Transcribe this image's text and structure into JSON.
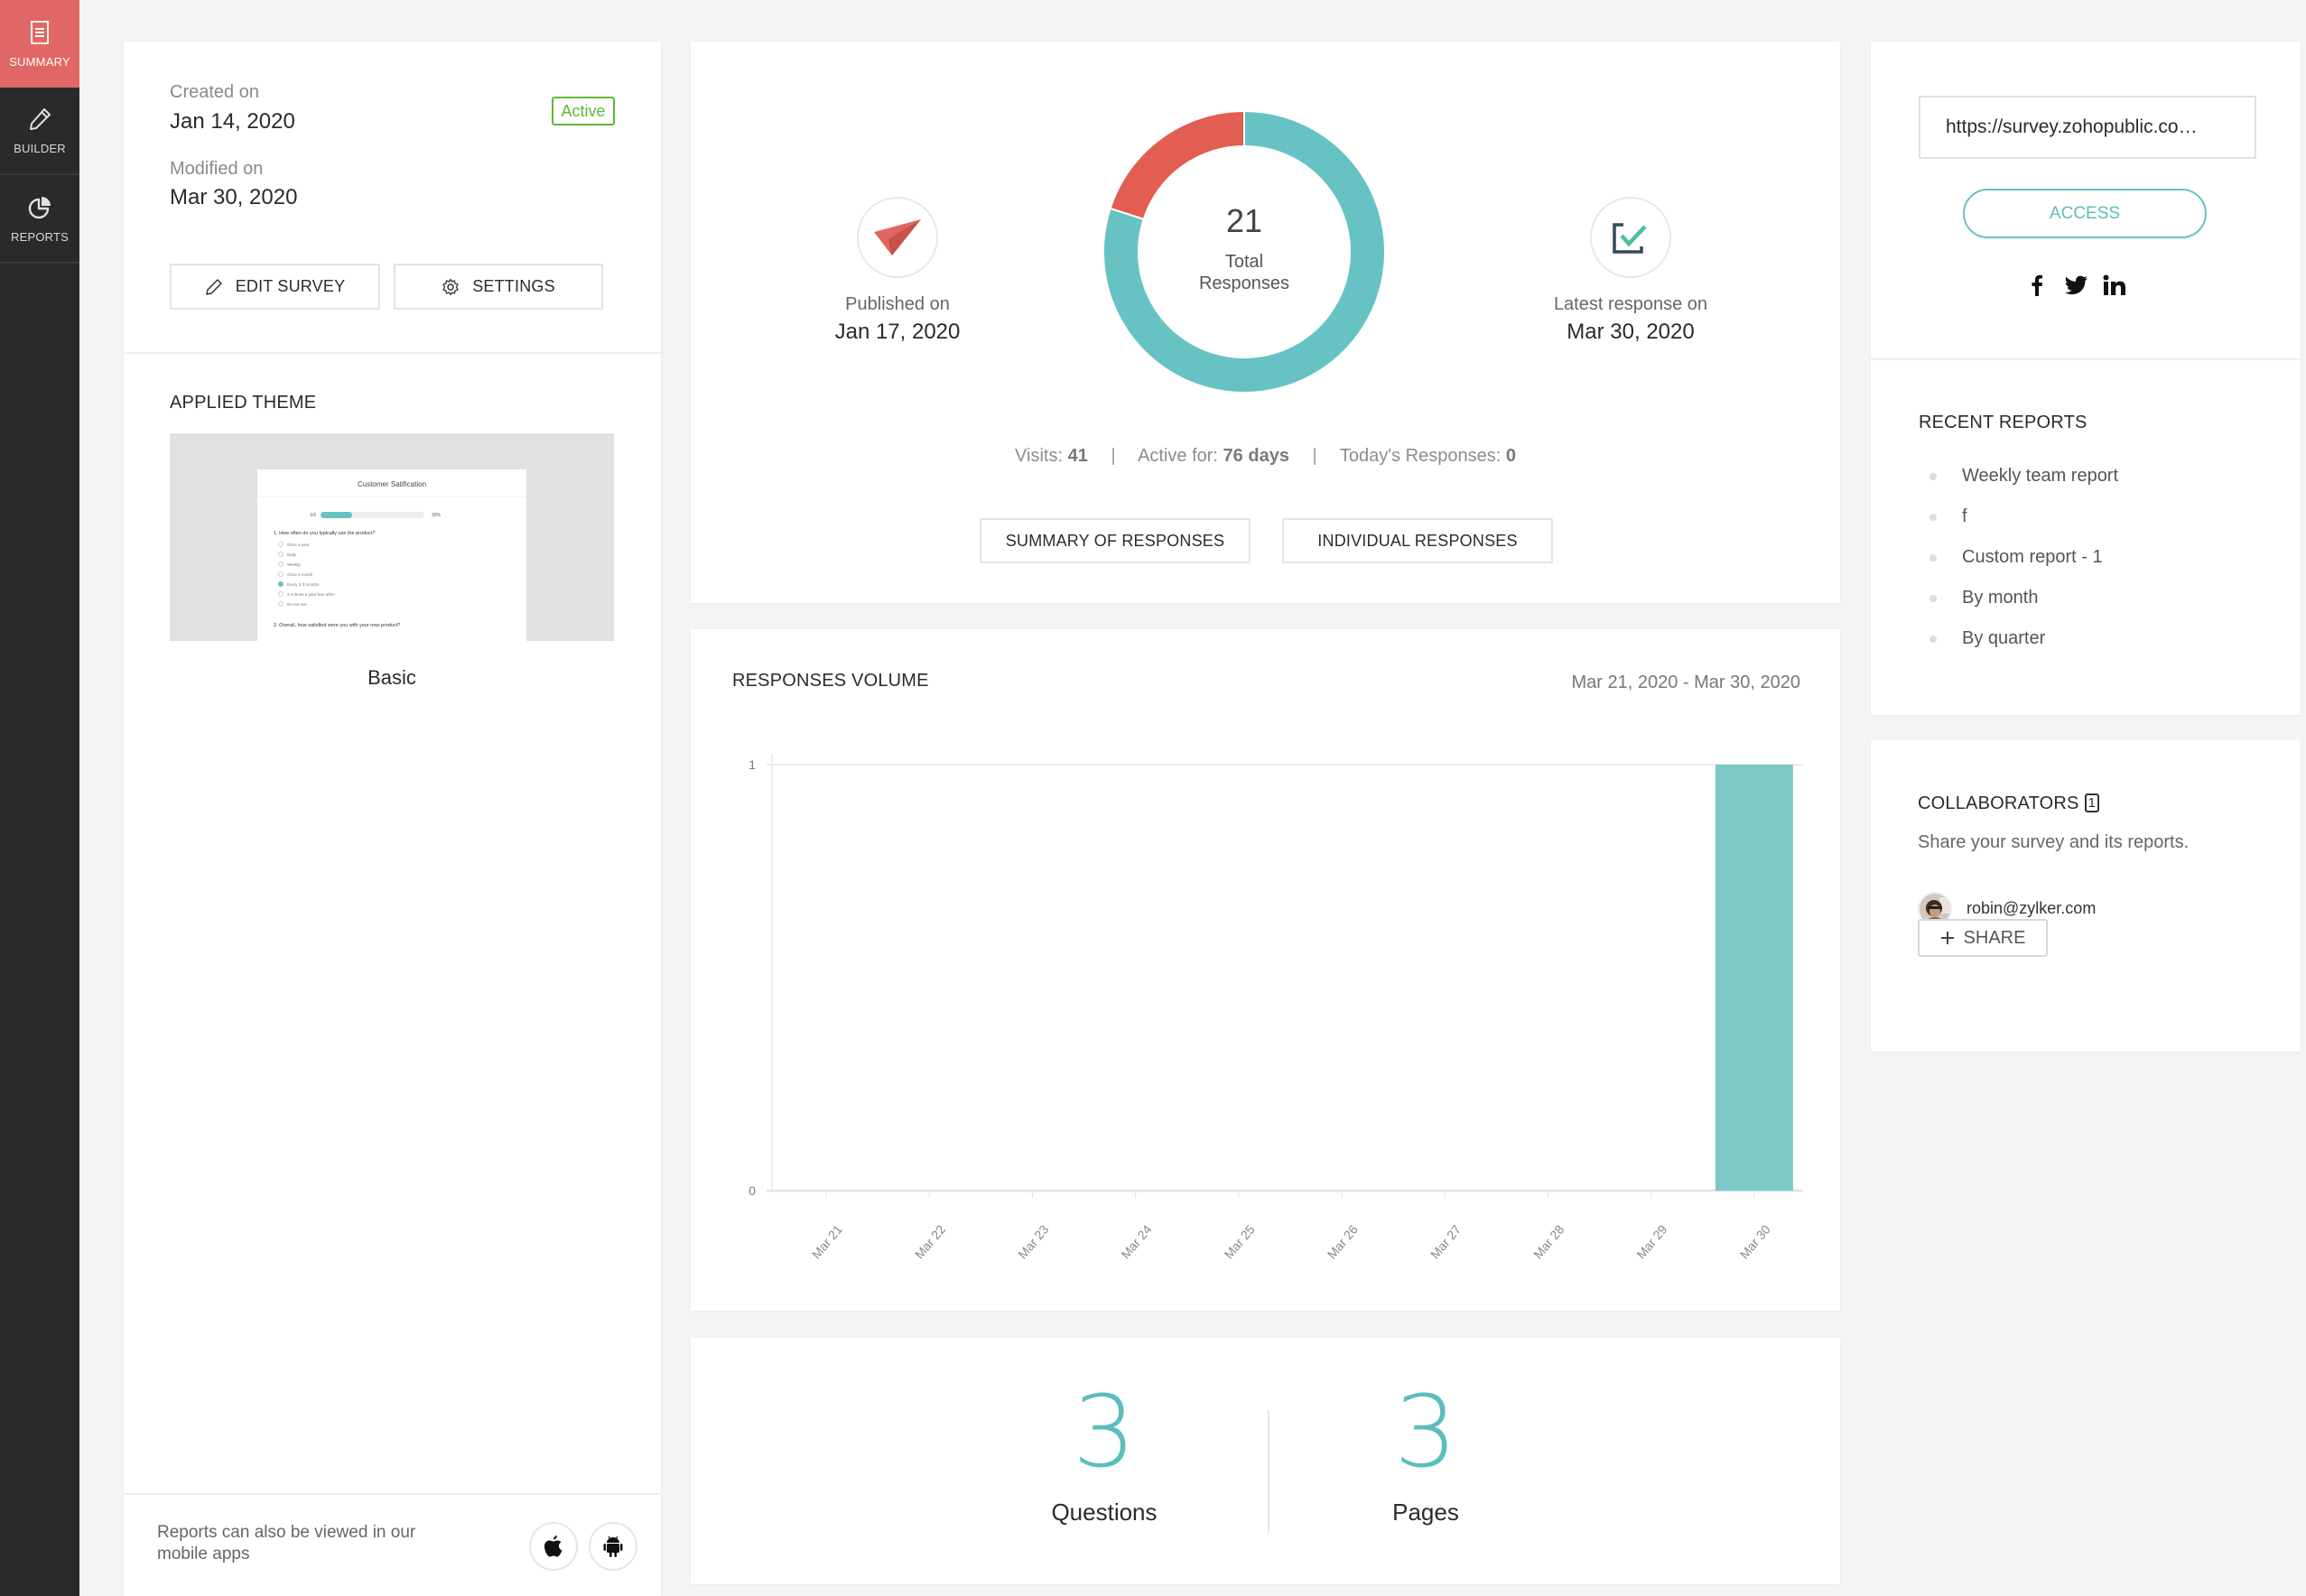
{
  "sidebar": {
    "items": [
      {
        "label": "SUMMARY",
        "icon": "document-icon",
        "active": true
      },
      {
        "label": "BUILDER",
        "icon": "pencil-icon",
        "active": false
      },
      {
        "label": "REPORTS",
        "icon": "pie-chart-icon",
        "active": false
      }
    ]
  },
  "survey_info": {
    "created_label": "Created on",
    "created_value": "Jan 14, 2020",
    "modified_label": "Modified on",
    "modified_value": "Mar 30, 2020",
    "status": "Active",
    "edit_button": "EDIT SURVEY",
    "settings_button": "SETTINGS"
  },
  "theme": {
    "title": "APPLIED THEME",
    "name": "Basic",
    "preview": {
      "survey_title": "Customer Satification",
      "progress_label": "1/3",
      "progress_percent_label": "30%",
      "progress_fraction": 0.3,
      "question1": "1. How often do you typically use the product?",
      "options": [
        {
          "label": "Once a year",
          "checked": false
        },
        {
          "label": "Daily",
          "checked": false
        },
        {
          "label": "Weekly",
          "checked": false
        },
        {
          "label": "Once a month",
          "checked": false
        },
        {
          "label": "Every 2-3 months",
          "checked": true
        },
        {
          "label": "2-3 times a year less often",
          "checked": false
        },
        {
          "label": "Do not use",
          "checked": false
        }
      ],
      "question2": "2. Overall, how satisfied were you with your new product?"
    }
  },
  "mobile": {
    "text": "Reports can also be viewed in our mobile apps",
    "apps": [
      "apple-icon",
      "android-icon"
    ]
  },
  "overview": {
    "published_label": "Published on",
    "published_value": "Jan 17, 2020",
    "total_value": "21",
    "total_label_line1": "Total",
    "total_label_line2": "Responses",
    "latest_label": "Latest response on",
    "latest_value": "Mar 30, 2020",
    "visits_label": "Visits:",
    "visits_value": "41",
    "active_label": "Active for:",
    "active_value": "76 days",
    "today_label": "Today's Responses:",
    "today_value": "0",
    "summary_button": "SUMMARY OF RESPONSES",
    "individual_button": "INDIVIDUAL RESPONSES",
    "donut": {
      "segments": [
        {
          "name": "primary",
          "fraction": 0.8,
          "color": "#67c3c3"
        },
        {
          "name": "secondary",
          "fraction": 0.2,
          "color": "#e25d52"
        }
      ]
    }
  },
  "volume": {
    "title": "RESPONSES VOLUME",
    "range": "Mar 21, 2020 - Mar 30, 2020"
  },
  "chart_data": {
    "type": "bar",
    "title": "RESPONSES VOLUME",
    "xlabel": "",
    "ylabel": "",
    "categories": [
      "Mar 21",
      "Mar 22",
      "Mar 23",
      "Mar 24",
      "Mar 25",
      "Mar 26",
      "Mar 27",
      "Mar 28",
      "Mar 29",
      "Mar 30"
    ],
    "values": [
      0,
      0,
      0,
      0,
      0,
      0,
      0,
      0,
      0,
      1
    ],
    "ylim": [
      0,
      1
    ],
    "yticks": [
      "0",
      "1"
    ],
    "grid": true,
    "color": "#7ac8c8"
  },
  "counts": {
    "questions_value": "3",
    "questions_label": "Questions",
    "pages_value": "3",
    "pages_label": "Pages"
  },
  "share": {
    "url": "https://survey.zohopublic.co…",
    "access_button": "ACCESS",
    "social": [
      "facebook-icon",
      "twitter-icon",
      "linkedin-icon"
    ]
  },
  "recent_reports": {
    "title": "RECENT REPORTS",
    "items": [
      "Weekly team report",
      "f",
      "Custom report - 1",
      "By month",
      "By quarter"
    ]
  },
  "collaborators": {
    "title": "COLLABORATORS",
    "count": "1",
    "subtitle": "Share your survey and its reports.",
    "users": [
      {
        "email": "robin@zylker.com"
      }
    ],
    "share_button": "SHARE"
  },
  "colors": {
    "accent": "#5cbdbd",
    "sidebar_active": "#e06765",
    "active_badge": "#5eb936",
    "donut_red": "#e25d52"
  }
}
